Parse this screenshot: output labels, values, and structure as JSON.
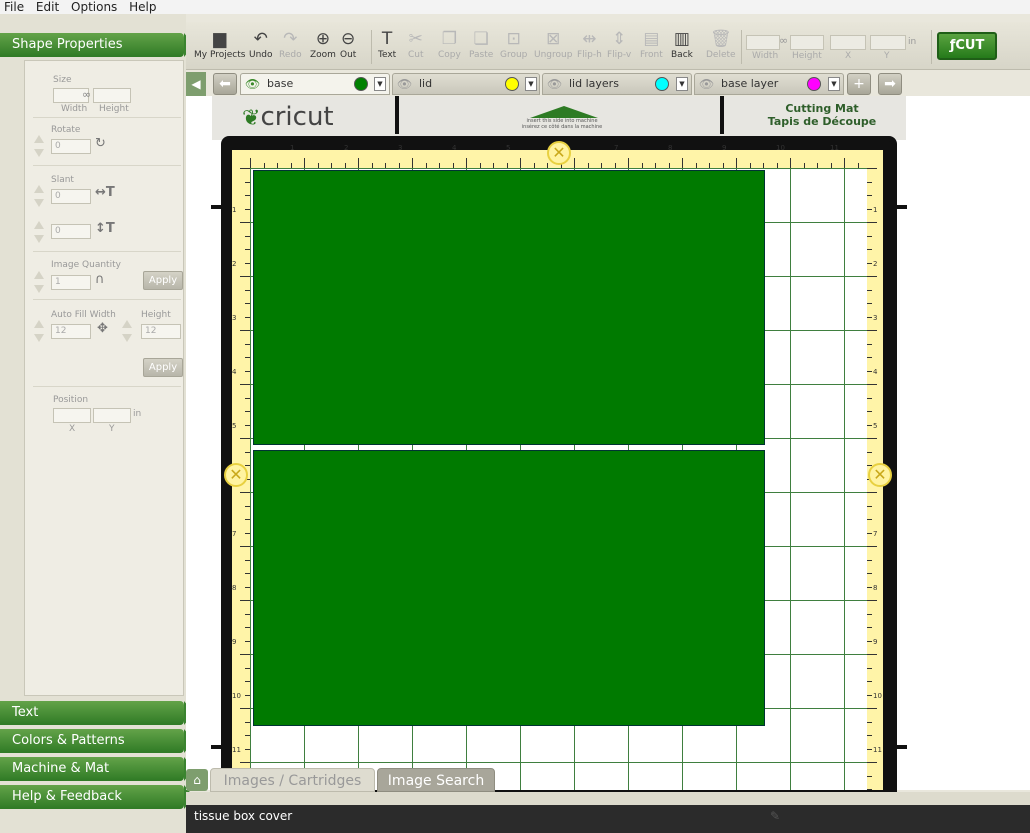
{
  "menu": [
    "File",
    "Edit",
    "Options",
    "Help"
  ],
  "left_panel": {
    "title": "Shape Properties",
    "size_label": "Size",
    "width_label": "Width",
    "height_label": "Height",
    "rotate_label": "Rotate",
    "rotate_value": "0",
    "slant_label": "Slant",
    "slant_value": "0",
    "flip_value": "0",
    "image_qty_label": "Image Quantity",
    "image_qty_value": "1",
    "apply_label": "Apply",
    "autofill_width_label": "Auto Fill Width",
    "autofill_width_value": "12",
    "autofill_height_label": "Height",
    "autofill_height_value": "12",
    "position_label": "Position",
    "position_unit": "in",
    "x_label": "X",
    "y_label": "Y",
    "sections": [
      "Text",
      "Colors & Patterns",
      "Machine & Mat",
      "Help & Feedback"
    ]
  },
  "toolbar": {
    "buttons": [
      {
        "label": "My Projects",
        "icon": "folder-icon",
        "glyph": "▆",
        "enabled": true
      },
      {
        "label": "Undo",
        "icon": "undo-icon",
        "glyph": "↶",
        "enabled": true
      },
      {
        "label": "Redo",
        "icon": "redo-icon",
        "glyph": "↷",
        "enabled": false
      },
      {
        "label": "Zoom",
        "icon": "zoom-in-icon",
        "glyph": "⊕",
        "enabled": true
      },
      {
        "label": "Out",
        "icon": "zoom-out-icon",
        "glyph": "⊖",
        "enabled": true
      },
      {
        "label": "Text",
        "icon": "text-icon",
        "glyph": "T",
        "enabled": true
      },
      {
        "label": "Cut",
        "icon": "scissors-icon",
        "glyph": "✂",
        "enabled": false
      },
      {
        "label": "Copy",
        "icon": "copy-icon",
        "glyph": "❐",
        "enabled": false
      },
      {
        "label": "Paste",
        "icon": "paste-icon",
        "glyph": "❏",
        "enabled": false
      },
      {
        "label": "Group",
        "icon": "group-icon",
        "glyph": "⊡",
        "enabled": false
      },
      {
        "label": "Ungroup",
        "icon": "ungroup-icon",
        "glyph": "⊠",
        "enabled": false
      },
      {
        "label": "Flip-h",
        "icon": "flip-horizontal-icon",
        "glyph": "⇹",
        "enabled": false
      },
      {
        "label": "Flip-v",
        "icon": "flip-vertical-icon",
        "glyph": "⇕",
        "enabled": false
      },
      {
        "label": "Front",
        "icon": "bring-front-icon",
        "glyph": "▤",
        "enabled": false
      },
      {
        "label": "Back",
        "icon": "send-back-icon",
        "glyph": "▥",
        "enabled": true
      },
      {
        "label": "Delete",
        "icon": "trash-icon",
        "glyph": "🗑",
        "enabled": false
      }
    ],
    "width_label": "Width",
    "height_label": "Height",
    "x_label": "X",
    "y_label": "Y",
    "unit": "in",
    "cut_label": "CUT"
  },
  "tabs": [
    {
      "label": "base",
      "color": "#008000",
      "active": true
    },
    {
      "label": "lid",
      "color": "#ffff00",
      "active": false
    },
    {
      "label": "lid layers",
      "color": "#00ffff",
      "active": false
    },
    {
      "label": "base layer",
      "color": "#ff00ff",
      "active": false
    }
  ],
  "mat": {
    "brand": "cricut",
    "insert_line1": "insert this side into machine",
    "insert_line2": "insérez ce côté dans la machine",
    "title_en": "Cutting Mat",
    "title_fr": "Tapis de Découpe",
    "inch_numbers": [
      "1",
      "2",
      "3",
      "4",
      "5",
      "6",
      "7",
      "8",
      "9",
      "10",
      "11"
    ]
  },
  "bottom_tabs": [
    "Images / Cartridges",
    "Image Search"
  ],
  "status": {
    "project_name": "tissue box cover"
  }
}
